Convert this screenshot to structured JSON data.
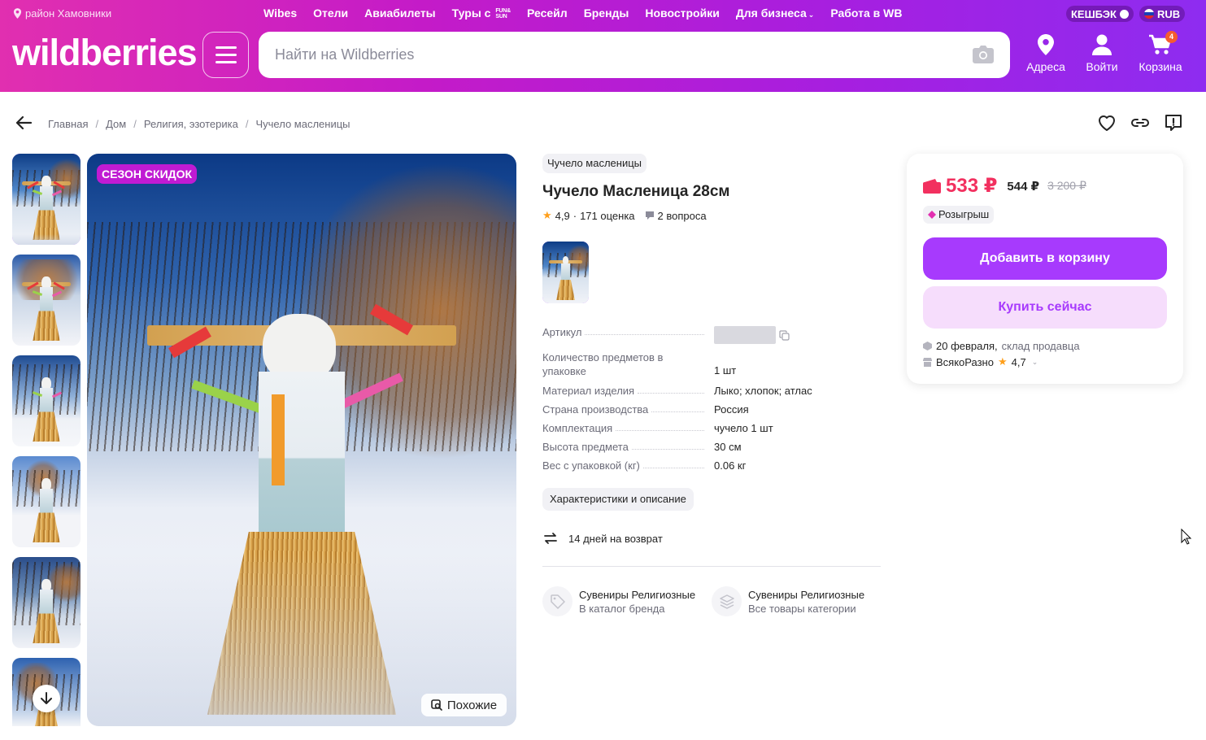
{
  "header": {
    "location": "район Хамовники",
    "nav": [
      "Wibes",
      "Отели",
      "Авиабилеты",
      "Туры с",
      "Ресейл",
      "Бренды",
      "Новостройки",
      "Для бизнеса",
      "Работа в WB"
    ],
    "tours_brand_top": "FUN&",
    "tours_brand_bottom": "SUN",
    "cashback": "КЕШБЭК",
    "currency": "RUB",
    "logo": "wildberries",
    "search_placeholder": "Найти на Wildberries",
    "actions": {
      "address": "Адреса",
      "login": "Войти",
      "cart": "Корзина"
    },
    "cart_count": "4",
    "colors": {
      "accent": "#a73afd",
      "gradient_start": "#e12fb0",
      "gradient_end": "#8e2cf0"
    }
  },
  "breadcrumb": [
    "Главная",
    "Дом",
    "Религия, эзотерика",
    "Чучело масленицы"
  ],
  "gallery": {
    "sale_badge": "СЕЗОН СКИДОК",
    "similar_label": "Похожие",
    "thumb_count": 6
  },
  "product": {
    "brand": "Чучело масленицы",
    "title": "Чучело Масленица 28см",
    "rating": "4,9",
    "ratings_count": "171 оценка",
    "questions": "2 вопроса",
    "specs": [
      {
        "key": "Артикул",
        "value": ""
      },
      {
        "key": "Количество предметов в упаковке",
        "value": "1 шт"
      },
      {
        "key": "Материал изделия",
        "value": "Лыко; хлопок; атлас"
      },
      {
        "key": "Страна производства",
        "value": "Россия"
      },
      {
        "key": "Комплектация",
        "value": "чучело 1 шт"
      },
      {
        "key": "Высота предмета",
        "value": "30 см"
      },
      {
        "key": "Вес с упаковкой (кг)",
        "value": "0.06 кг"
      }
    ],
    "specs_two_line": {
      "line1": "Количество предметов в",
      "line2": "упаковке"
    },
    "characteristics_button": "Характеристики и описание",
    "return_policy": "14 дней на возврат",
    "links": [
      {
        "title": "Сувениры Религиозные",
        "sub": "В каталог бренда"
      },
      {
        "title": "Сувениры Религиозные",
        "sub": "Все товары категории"
      }
    ]
  },
  "buy": {
    "price": "533 ₽",
    "price_second": "544 ₽",
    "price_old": "3 200 ₽",
    "raffle": "Розыгрыш",
    "add_to_cart": "Добавить в корзину",
    "buy_now": "Купить сейчас",
    "delivery_date": "20 февраля,",
    "delivery_source": "склад продавца",
    "seller": "ВсякоРазно",
    "seller_rating": "4,7",
    "price_color": "#f2305f"
  }
}
